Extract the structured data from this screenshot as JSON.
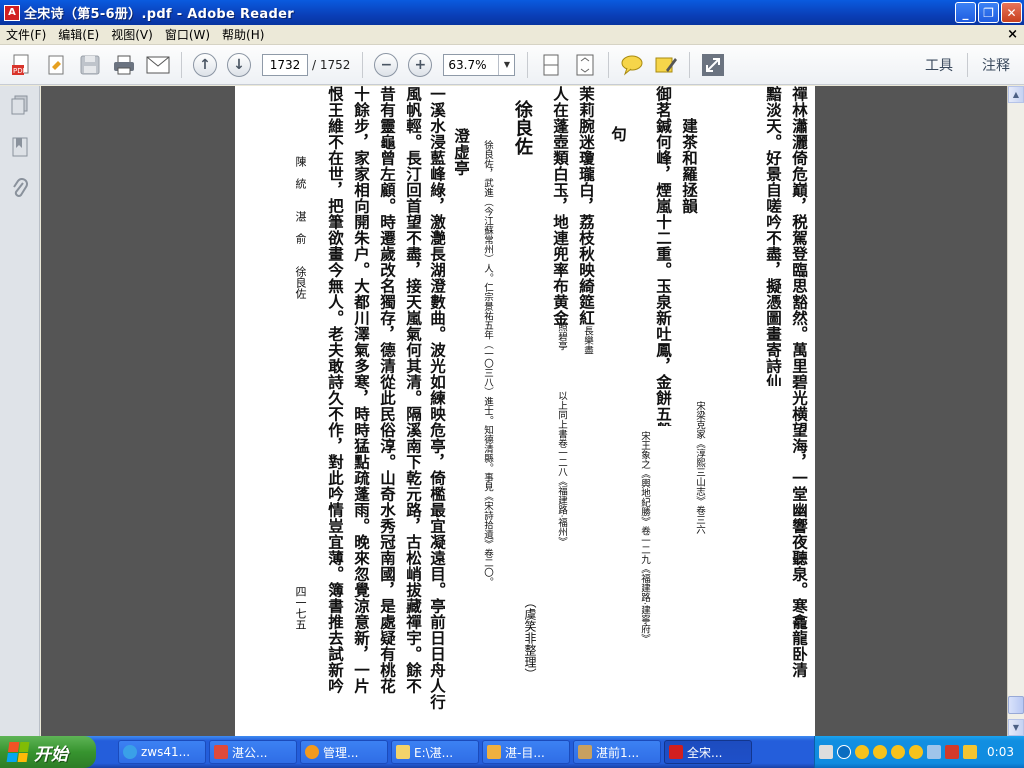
{
  "window": {
    "title": "全宋诗（第5-6册）.pdf - Adobe Reader",
    "minimize": "_",
    "restore": "❐",
    "close": "✕"
  },
  "menu": {
    "items": [
      "文件(F)",
      "编辑(E)",
      "视图(V)",
      "窗口(W)",
      "帮助(H)"
    ],
    "close": "×"
  },
  "toolbar": {
    "page_current": "1732",
    "page_total": "/ 1752",
    "zoom": "63.7%",
    "tools_label": "工具",
    "comment_label": "注释"
  },
  "document": {
    "columns": [
      "禪林瀟灑倚危巔，税駕登臨思豁然。萬里碧光横望海，一堂幽響夜聽泉。寒龕龍卧清",
      "黯淡天。好景自嗟吟不盡，擬憑圖畫寄詩仙。",
      "建茶和羅拯韻",
      "御茗鍼何峰，煙嵐十二重。玉泉新吐鳳，金餅五盤龍。",
      "句",
      "茉莉腕迷瓊瓏白，荔枝秋映綺筵紅。",
      "人在蓬壺類白玉，地連兜率布黄金。",
      "徐良佐",
      "澄虚亭",
      "一溪水浸藍峰綠，激灔長湖澄數曲。波光如練映危亭，倚檻最宜凝遠目。亭前日日舟人行",
      "風帆輕。長汀回首望不盡，接天嵐氣何其清。隔溪南下乾元路，古松峭拔藏禪宇。餘不",
      "昔有靈龜曾左顧。時遷歲改名獨存，德清從此民俗淳。山奇水秀冠南國，是處疑有桃花",
      "十餘步，家家相向開朱户。大都川澤氣多寒，時時猛點疏蓬雨。晚來忽覺涼意新，一片",
      "恨王維不在世，把筆欲畫今無人。老夫敢詩久不作，對此吟情豈宜薄。簿書推去試新吟"
    ],
    "notes": {
      "line1": "宋梁克家《淳熙三山志》卷三六",
      "line4": "宋王象之《輿地紀勝》卷一二九《福建路·建寧府》",
      "line6": "長樂盡",
      "line7a": "照碧亭",
      "line7b": "以上同上書卷一二八《福建路·福州》",
      "author_bio": "徐良佐，武進（今江蘇常州）人。仁宗景祐五年（一〇三八）進士。知德清縣。事見《宋詩拾遺》卷二〇。",
      "editor": "（虞笑非整理）",
      "next_authors": "陳　統　　湛　俞　　徐良佐",
      "page_number": "四一七五"
    }
  },
  "taskbar": {
    "start": "开始",
    "tasks": [
      "zws41...",
      "湛公...",
      "管理...",
      "E:\\湛...",
      "湛-目...",
      "湛前1...",
      "全宋..."
    ],
    "clock": "0:03"
  },
  "colors": {
    "titlebar": "#0a3fb8",
    "doc_background": "#555555",
    "taskbar": "#245edb",
    "start_button": "#37942f"
  }
}
